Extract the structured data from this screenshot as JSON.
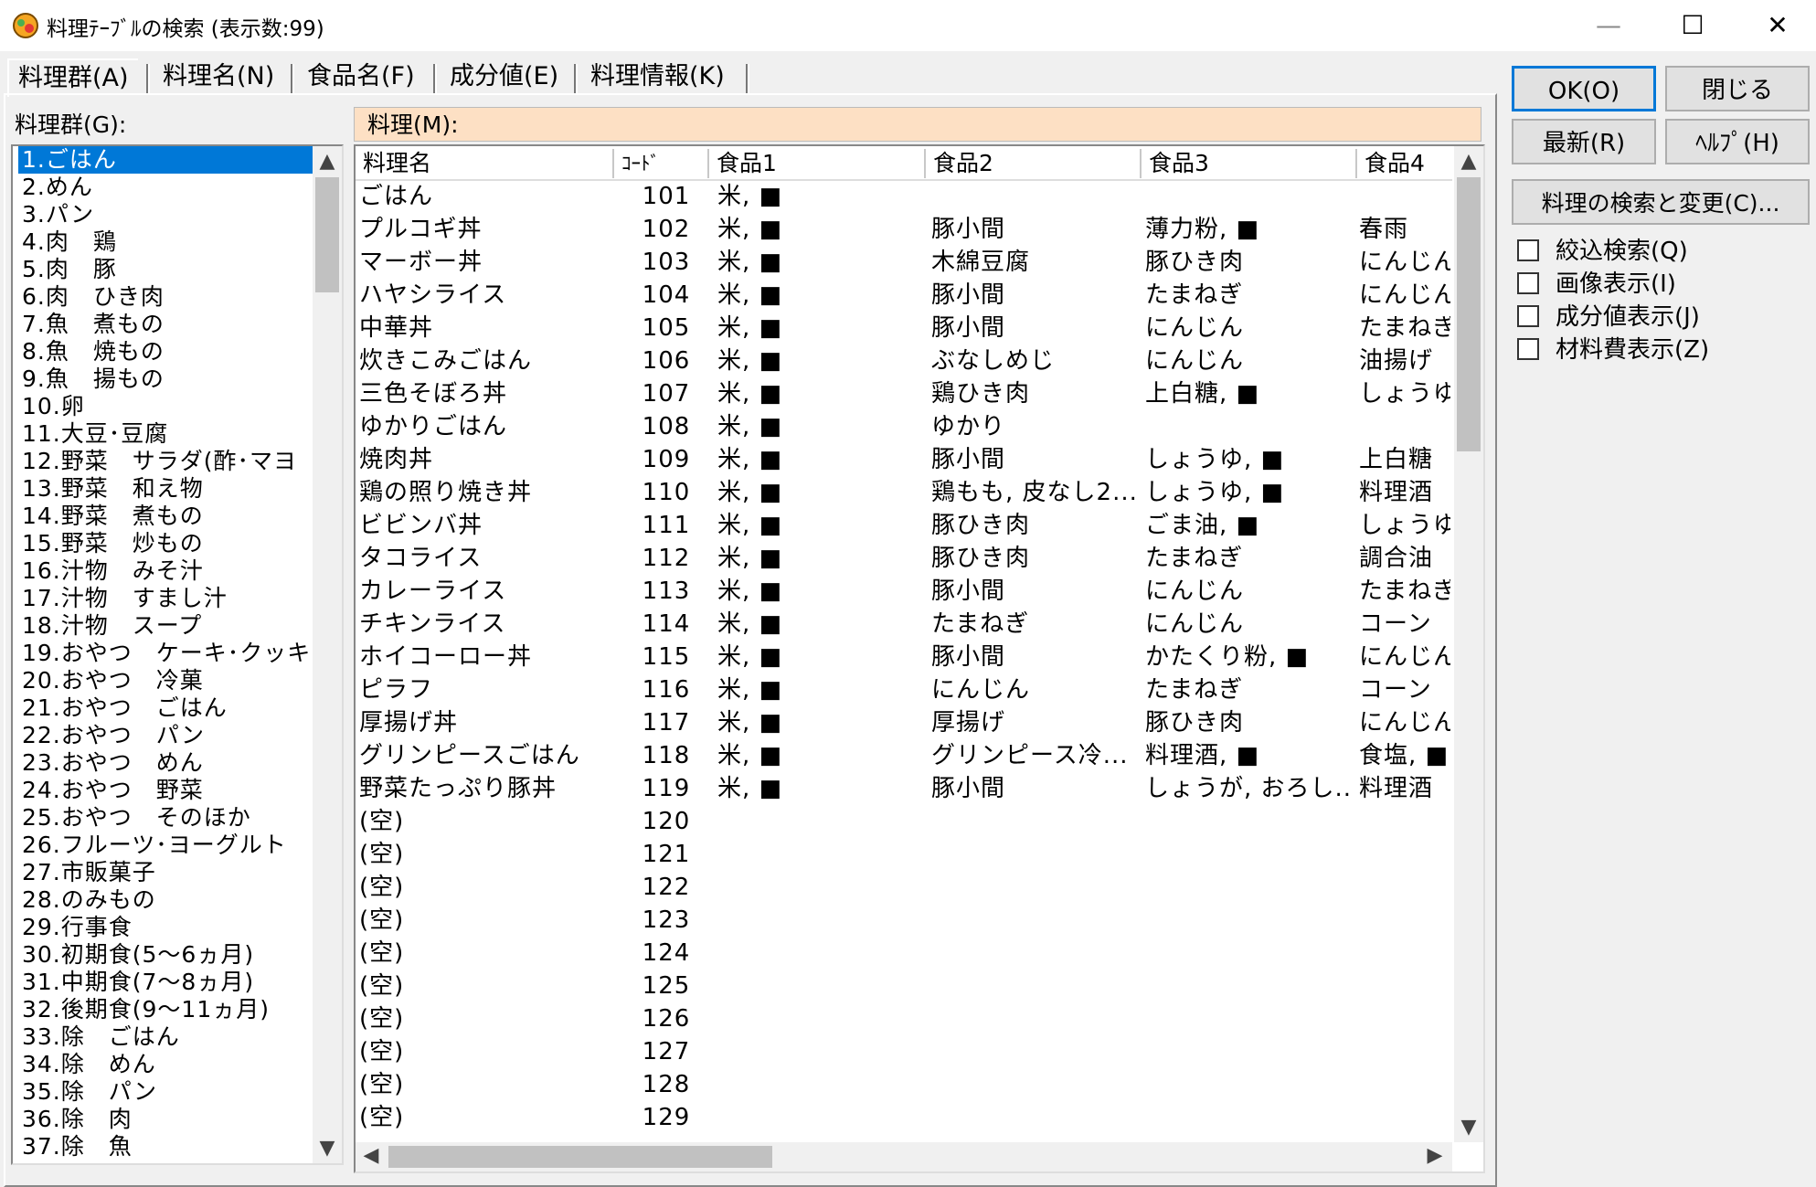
{
  "window": {
    "title": "料理ﾃｰﾌﾞﾙの検索 (表示数:99)",
    "minimize": "—",
    "maximize": "☐",
    "close": "✕"
  },
  "tabs": [
    {
      "label": "料理群(A)"
    },
    {
      "label": "料理名(N)"
    },
    {
      "label": "食品名(F)"
    },
    {
      "label": "成分値(E)"
    },
    {
      "label": "料理情報(K)"
    }
  ],
  "group_panel": {
    "label": "料理群(G):",
    "items": [
      "1.ごはん",
      "2.めん",
      "3.パン",
      "4.肉　鶏",
      "5.肉　豚",
      "6.肉　ひき肉",
      "7.魚　煮もの",
      "8.魚　焼もの",
      "9.魚　揚もの",
      "10.卵",
      "11.大豆･豆腐",
      "12.野菜　サラダ(酢･マヨ",
      "13.野菜　和え物",
      "14.野菜　煮もの",
      "15.野菜　炒もの",
      "16.汁物　みそ汁",
      "17.汁物　すまし汁",
      "18.汁物　スープ",
      "19.おやつ　ケーキ･クッキ",
      "20.おやつ　冷菓",
      "21.おやつ　ごはん",
      "22.おやつ　パン",
      "23.おやつ　めん",
      "24.おやつ　野菜",
      "25.おやつ　そのほか",
      "26.フルーツ･ヨーグルト",
      "27.市販菓子",
      "28.のみもの",
      "29.行事食",
      "30.初期食(5〜6ヵ月)",
      "31.中期食(7〜8ヵ月)",
      "32.後期食(9〜11ヵ月)",
      "33.除　ごはん",
      "34.除　めん",
      "35.除　パン",
      "36.除　肉",
      "37.除　魚"
    ]
  },
  "dish_panel": {
    "label": "料理(M):",
    "columns": [
      "料理名",
      "ｺｰﾄﾞ",
      "食品1",
      "食品2",
      "食品3",
      "食品4"
    ],
    "rows": [
      [
        "ごはん",
        "101",
        "米, ■",
        "",
        "",
        ""
      ],
      [
        "プルコギ丼",
        "102",
        "米, ■",
        "豚小間",
        "薄力粉, ■",
        "春雨"
      ],
      [
        "マーボー丼",
        "103",
        "米, ■",
        "木綿豆腐",
        "豚ひき肉",
        "にんじん"
      ],
      [
        "ハヤシライス",
        "104",
        "米, ■",
        "豚小間",
        "たまねぎ",
        "にんじん"
      ],
      [
        "中華丼",
        "105",
        "米, ■",
        "豚小間",
        "にんじん",
        "たまねぎ"
      ],
      [
        "炊きこみごはん",
        "106",
        "米, ■",
        "ぶなしめじ",
        "にんじん",
        "油揚げ"
      ],
      [
        "三色そぼろ丼",
        "107",
        "米, ■",
        "鶏ひき肉",
        "上白糖, ■",
        "しょうゆ"
      ],
      [
        "ゆかりごはん",
        "108",
        "米, ■",
        "ゆかり",
        "",
        ""
      ],
      [
        "焼肉丼",
        "109",
        "米, ■",
        "豚小間",
        "しょうゆ, ■",
        "上白糖"
      ],
      [
        "鶏の照り焼き丼",
        "110",
        "米, ■",
        "鶏もも, 皮なし2...",
        "しょうゆ, ■",
        "料理酒"
      ],
      [
        "ビビンバ丼",
        "111",
        "米, ■",
        "豚ひき肉",
        "ごま油, ■",
        "しょうゆ"
      ],
      [
        "タコライス",
        "112",
        "米, ■",
        "豚ひき肉",
        "たまねぎ",
        "調合油"
      ],
      [
        "カレーライス",
        "113",
        "米, ■",
        "豚小間",
        "にんじん",
        "たまねぎ"
      ],
      [
        "チキンライス",
        "114",
        "米, ■",
        "たまねぎ",
        "にんじん",
        "コーン"
      ],
      [
        "ホイコーロー丼",
        "115",
        "米, ■",
        "豚小間",
        "かたくり粉, ■",
        "にんじん"
      ],
      [
        "ピラフ",
        "116",
        "米, ■",
        "にんじん",
        "たまねぎ",
        "コーン"
      ],
      [
        "厚揚げ丼",
        "117",
        "米, ■",
        "厚揚げ",
        "豚ひき肉",
        "にんじん"
      ],
      [
        "グリンピースごはん",
        "118",
        "米, ■",
        "グリンピース冷...",
        "料理酒, ■",
        "食塩, ■"
      ],
      [
        "野菜たっぷり豚丼",
        "119",
        "米, ■",
        "豚小間",
        "しょうが, おろし...",
        "料理酒"
      ],
      [
        "(空)",
        "120",
        "",
        "",
        "",
        ""
      ],
      [
        "(空)",
        "121",
        "",
        "",
        "",
        ""
      ],
      [
        "(空)",
        "122",
        "",
        "",
        "",
        ""
      ],
      [
        "(空)",
        "123",
        "",
        "",
        "",
        ""
      ],
      [
        "(空)",
        "124",
        "",
        "",
        "",
        ""
      ],
      [
        "(空)",
        "125",
        "",
        "",
        "",
        ""
      ],
      [
        "(空)",
        "126",
        "",
        "",
        "",
        ""
      ],
      [
        "(空)",
        "127",
        "",
        "",
        "",
        ""
      ],
      [
        "(空)",
        "128",
        "",
        "",
        "",
        ""
      ],
      [
        "(空)",
        "129",
        "",
        "",
        "",
        ""
      ]
    ]
  },
  "buttons": {
    "ok": "OK(O)",
    "close": "閉じる",
    "refresh": "最新(R)",
    "help": "ﾍﾙﾌﾟ(H)",
    "search_change": "料理の検索と変更(C)..."
  },
  "checkboxes": [
    {
      "label": "絞込検索(Q)"
    },
    {
      "label": "画像表示(I)"
    },
    {
      "label": "成分値表示(J)"
    },
    {
      "label": "材料費表示(Z)"
    }
  ],
  "colors": {
    "selection": "#0078d7",
    "dish_header": "#fde0c4"
  }
}
